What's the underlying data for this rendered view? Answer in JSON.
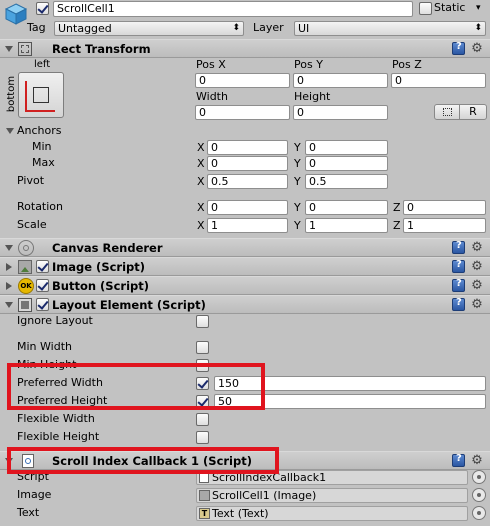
{
  "gameobject": {
    "name": "ScrollCell1",
    "static_label": "Static",
    "tag_label": "Tag",
    "tag_value": "Untagged",
    "layer_label": "Layer",
    "layer_value": "UI"
  },
  "rect_transform": {
    "title": "Rect Transform",
    "anchor_preset_top": "left",
    "anchor_preset_side": "bottom",
    "headers": {
      "pos_x": "Pos X",
      "pos_y": "Pos Y",
      "pos_z": "Pos Z",
      "width": "Width",
      "height": "Height"
    },
    "pos_x": "0",
    "pos_y": "0",
    "pos_z": "0",
    "width": "0",
    "height": "0",
    "raw_button": "R",
    "anchors_label": "Anchors",
    "min_label": "Min",
    "min_x": "0",
    "min_y": "0",
    "max_label": "Max",
    "max_x": "0",
    "max_y": "0",
    "pivot_label": "Pivot",
    "pivot_x": "0.5",
    "pivot_y": "0.5",
    "rotation_label": "Rotation",
    "rot_x": "0",
    "rot_y": "0",
    "rot_z": "0",
    "scale_label": "Scale",
    "scale_x": "1",
    "scale_y": "1",
    "scale_z": "1",
    "axis_x": "X",
    "axis_y": "Y",
    "axis_z": "Z"
  },
  "components": {
    "canvas_renderer": "Canvas Renderer",
    "image": "Image (Script)",
    "button": "Button (Script)",
    "button_icon_text": "OK",
    "layout_element": "Layout Element (Script)",
    "scroll_callback": "Scroll Index Callback 1 (Script)"
  },
  "layout_element": {
    "ignore_layout_label": "Ignore Layout",
    "min_width_label": "Min Width",
    "min_height_label": "Min Height",
    "preferred_width_label": "Preferred Width",
    "preferred_width_value": "150",
    "preferred_height_label": "Preferred Height",
    "preferred_height_value": "50",
    "flexible_width_label": "Flexible Width",
    "flexible_height_label": "Flexible Height"
  },
  "scroll_callback": {
    "script_label": "Script",
    "script_value": "ScrollIndexCallback1",
    "image_label": "Image",
    "image_value": "ScrollCell1 (Image)",
    "text_label": "Text",
    "text_value": "Text (Text)"
  },
  "colors": {
    "highlight": "#e0141e",
    "panel": "#c2c2c2"
  }
}
